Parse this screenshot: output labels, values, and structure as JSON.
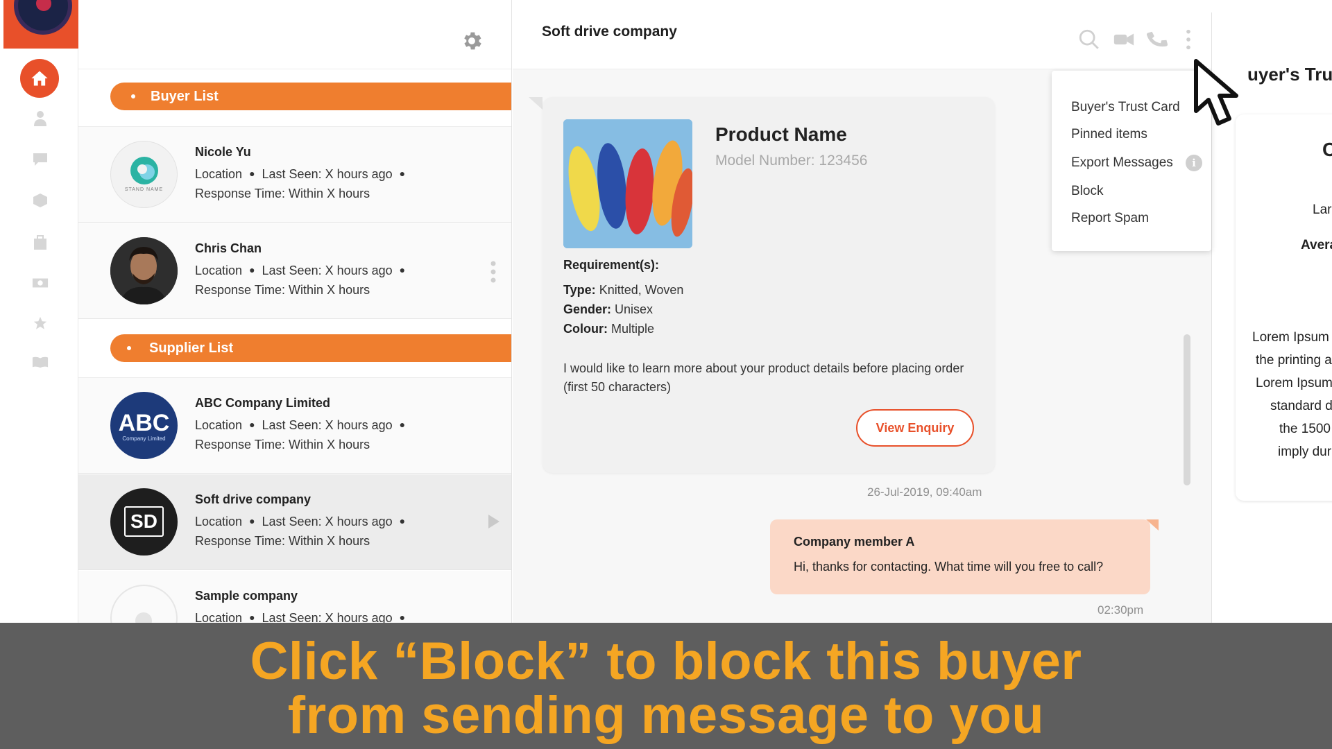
{
  "colors": {
    "accent": "#e8502a",
    "section_bar": "#ef7e2f",
    "reply_bubble": "#fbd8c7",
    "caption_bg": "#5e5e5e",
    "caption_text": "#f5a623"
  },
  "rail": {
    "icons": [
      "home-icon",
      "user-icon",
      "chat-icon",
      "cube-icon",
      "bag-icon",
      "money-icon",
      "star-icon",
      "book-icon"
    ]
  },
  "buyer_section": {
    "label": "Buyer List"
  },
  "supplier_section": {
    "label": "Supplier List"
  },
  "contacts": [
    {
      "name": "Nicole Yu",
      "location": "Location",
      "last_seen": "Last Seen: X hours ago",
      "response": "Response Time: Within X hours",
      "avatar_text": "STAND NAME"
    },
    {
      "name": "Chris Chan",
      "location": "Location",
      "last_seen": "Last Seen: X hours ago",
      "response": "Response Time: Within X hours"
    },
    {
      "name": "ABC Company Limited",
      "location": "Location",
      "last_seen": "Last Seen: X hours ago",
      "response": "Response Time: Within X hours",
      "avatar_text": "ABC",
      "avatar_sub": "Company Limited"
    },
    {
      "name": "Soft drive company",
      "location": "Location",
      "last_seen": "Last Seen: X hours ago",
      "response": "Response Time: Within X hours",
      "avatar_text": "SD"
    },
    {
      "name": "Sample company",
      "location": "Location",
      "last_seen": "Last Seen: X hours ago"
    }
  ],
  "chat": {
    "title": "Soft drive company",
    "header_icons": [
      "search-icon",
      "video-icon",
      "phone-icon",
      "more-vertical-icon"
    ]
  },
  "enquiry": {
    "product_name": "Product Name",
    "model_number": "Model Number: 123456",
    "requirements_title": "Requirement(s):",
    "type_label": "Type:",
    "type_value": "Knitted, Woven",
    "gender_label": "Gender:",
    "gender_value": "Unisex",
    "colour_label": "Colour:",
    "colour_value": "Multiple",
    "message": "I would like to learn more about your product details before placing order (first 50 characters)",
    "button": "View Enquiry",
    "timestamp": "26-Jul-2019, 09:40am"
  },
  "reply": {
    "sender": "Company member A",
    "text": "Hi, thanks for contacting. What time will you free to call?",
    "timestamp": "02:30pm"
  },
  "menu": {
    "items": [
      "Buyer's Trust Card",
      "Pinned items",
      "Export Messages",
      "Block",
      "Report Spam"
    ]
  },
  "trust_panel": {
    "title": "uyer's Trus",
    "initial": "C",
    "label_1": "Lar",
    "label_2": "Avera",
    "lorem": [
      "Lorem Ipsum",
      "the printing a",
      "Lorem Ipsum",
      "standard d",
      "the 1500",
      "imply dur"
    ]
  },
  "caption": {
    "line1": "Click “Block” to block this buyer",
    "line2": "from sending message to you"
  }
}
